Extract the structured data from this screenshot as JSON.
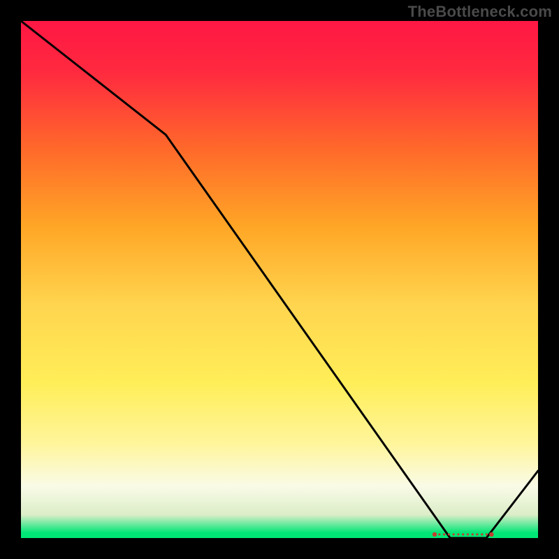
{
  "watermark": "TheBottleneck.com",
  "chart_data": {
    "type": "line",
    "title": "",
    "xlabel": "",
    "ylabel": "",
    "xlim": [
      0,
      100
    ],
    "ylim": [
      0,
      100
    ],
    "x": [
      0,
      28,
      83,
      90,
      100
    ],
    "values": [
      100,
      78,
      0,
      0,
      13
    ],
    "gradient_stops": [
      {
        "offset": 0.0,
        "color": "#ff1744"
      },
      {
        "offset": 0.1,
        "color": "#ff2a3f"
      },
      {
        "offset": 0.25,
        "color": "#ff6a2a"
      },
      {
        "offset": 0.4,
        "color": "#ffa726"
      },
      {
        "offset": 0.55,
        "color": "#ffd54f"
      },
      {
        "offset": 0.7,
        "color": "#ffee58"
      },
      {
        "offset": 0.82,
        "color": "#fff59d"
      },
      {
        "offset": 0.9,
        "color": "#f9fbe7"
      },
      {
        "offset": 0.955,
        "color": "#dcedc8"
      },
      {
        "offset": 0.99,
        "color": "#00e676"
      }
    ],
    "markers": {
      "y": 0.7,
      "x_start": 80,
      "x_end": 91,
      "color": "#c43e2f"
    }
  }
}
